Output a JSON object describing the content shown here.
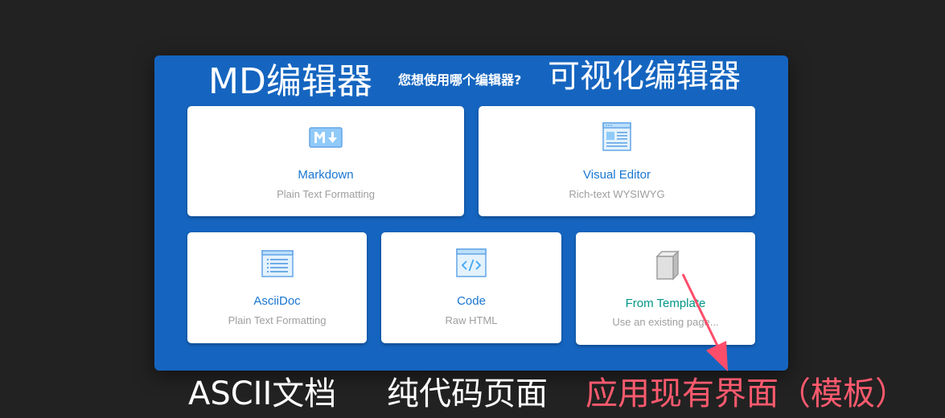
{
  "dialog": {
    "annotation_md": "MD编辑器",
    "question": "您想使用哪个编辑器?",
    "annotation_visual": "可视化编辑器"
  },
  "cards": {
    "markdown": {
      "title": "Markdown",
      "subtitle": "Plain Text Formatting",
      "icon": "markdown-icon"
    },
    "visual": {
      "title": "Visual Editor",
      "subtitle": "Rich-text WYSIWYG",
      "icon": "visual-editor-icon"
    },
    "asciidoc": {
      "title": "AsciiDoc",
      "subtitle": "Plain Text Formatting",
      "icon": "asciidoc-icon"
    },
    "code": {
      "title": "Code",
      "subtitle": "Raw HTML",
      "icon": "code-icon"
    },
    "template": {
      "title": "From Template",
      "subtitle": "Use an existing page...",
      "icon": "box-icon"
    }
  },
  "annotations": {
    "ascii": "ASCII文档",
    "code": "纯代码页面",
    "template": "应用现有界面（模板）"
  },
  "colors": {
    "page_background": "#222222",
    "dialog_background": "#1565c0",
    "card_title": "#1976d2",
    "template_title": "#009688",
    "subtitle": "#9e9e9e",
    "annotation_red": "#ff5a6e",
    "arrow": "#ff4d6a"
  }
}
